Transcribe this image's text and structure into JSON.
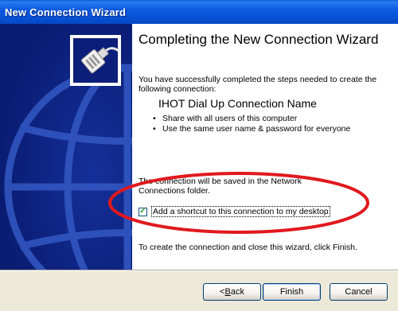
{
  "window": {
    "title": "New Connection Wizard"
  },
  "content": {
    "heading": "Completing the New Connection Wizard",
    "intro": "You have successfully completed the steps needed to create the following connection:",
    "connection_name": "IHOT Dial Up Connection Name",
    "bullets": [
      "Share with all users of this computer",
      "Use the same user name & password for everyone"
    ],
    "save_note": "The connection will be saved in the Network Connections folder.",
    "shortcut_checkbox": {
      "label": "Add a shortcut to this connection to my desktop",
      "checked": true
    },
    "finish_note": "To create the connection and close this wizard, click Finish."
  },
  "buttons": {
    "back_prefix": "< ",
    "back_mnemonic": "B",
    "back_rest": "ack",
    "finish": "Finish",
    "cancel": "Cancel"
  },
  "annotation": {
    "color": "#e0191e"
  },
  "icons": {
    "connector": "network-plug-icon",
    "check": "checkmark-icon"
  }
}
